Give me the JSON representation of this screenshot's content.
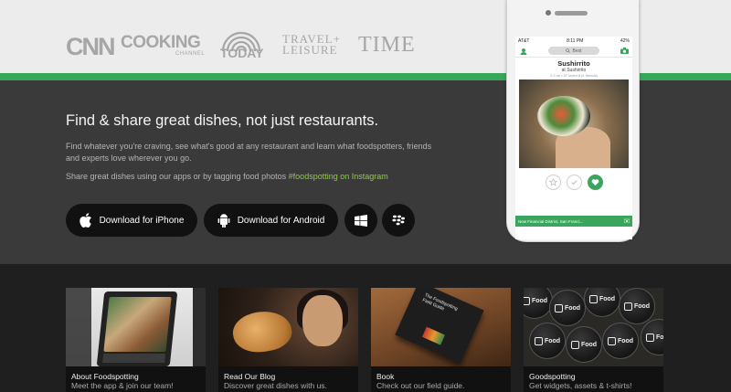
{
  "press": {
    "cnn": "CNN",
    "cooking_main": "COOKING",
    "cooking_sub": "CHANNEL",
    "today": "TODAY",
    "travel_line1": "TRAVEL+",
    "travel_line2": "LEISURE",
    "time": "TIME"
  },
  "hero": {
    "title": "Find & share great dishes, not just restaurants.",
    "description": "Find whatever you're craving, see what's good at any restaurant and learn what foodspotters, friends and experts love wherever you go.",
    "share_prefix": "Share great dishes using our apps or by tagging food photos ",
    "share_hashtag": "#foodspotting on Instagram"
  },
  "buttons": {
    "iphone": "Download for iPhone",
    "android": "Download for Android",
    "windows_icon": "windows-logo-icon",
    "blackberry_icon": "blackberry-logo-icon"
  },
  "phone": {
    "carrier": "AT&T",
    "time": "8:11 PM",
    "battery": "42%",
    "search_placeholder": "Best",
    "dish_name": "Sushirrito",
    "place": "at Sushirrito",
    "meta": "0.3 mi  •  37 loved it (4 friends)",
    "location": "New Financial District, San Franci..."
  },
  "tiles": [
    {
      "title": "About Foodspotting",
      "subtitle": "Meet the app & join our team!"
    },
    {
      "title": "Read Our Blog",
      "subtitle": "Discover great dishes with us."
    },
    {
      "title": "Book",
      "subtitle": "Check out our field guide."
    },
    {
      "title": "Goodspotting",
      "subtitle": "Get widgets, assets & t-shirts!"
    }
  ],
  "book_cover": "The Foodspotting Field Guide",
  "badge_text": "Food",
  "colors": {
    "accent_green": "#38a75a",
    "hashtag_green": "#8ccf3e",
    "hero_bg": "#3a3a3b",
    "button_bg": "#111111"
  }
}
